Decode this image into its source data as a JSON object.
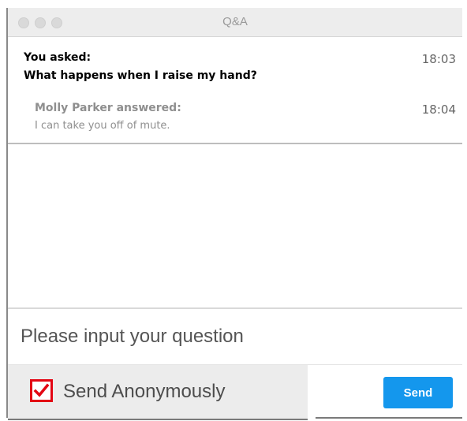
{
  "window": {
    "title": "Q&A"
  },
  "thread": {
    "question": {
      "label": "You asked:",
      "text": "What happens when I raise my hand?",
      "time": "18:03"
    },
    "answer": {
      "label": "Molly Parker answered:",
      "text": "I can take you off of mute.",
      "time": "18:04"
    }
  },
  "compose": {
    "placeholder": "Please input your question",
    "value": ""
  },
  "options": {
    "anonymous_label": "Send Anonymously",
    "anonymous_checked": true
  },
  "actions": {
    "send_label": "Send"
  },
  "colors": {
    "accent": "#1497ed",
    "highlight": "#e30613"
  },
  "icons": {
    "checkbox": "checkmark-icon"
  }
}
